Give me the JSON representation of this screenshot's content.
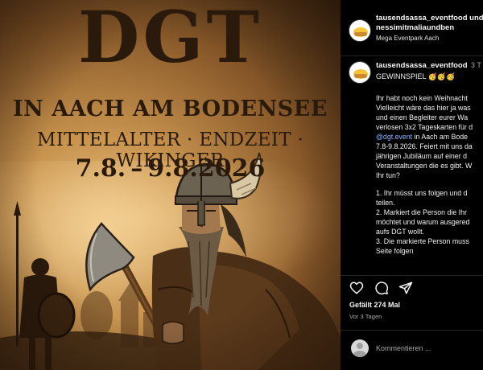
{
  "poster": {
    "title": "DGT",
    "location": "IN AACH AM BODENSEE",
    "themes": "MITTELALTER · ENDZEIT · WIKINGER",
    "dates": "7.8. – 9.8.2026"
  },
  "header": {
    "account_line1": "tausendsassa_eventfood und",
    "account_line2": "nessimitmaliaundben",
    "location": "Mega Eventpark Aach"
  },
  "post": {
    "author": "tausendsassa_eventfood",
    "age": "3 T",
    "tag": "GEWINNSPIEL 🥳🥳🥳",
    "paragraph1": [
      "Ihr habt noch kein Weihnacht",
      "Vielleicht wäre das hier ja was",
      "und einen Begleiter eurer Wa",
      "verlosen 3x2 Tageskarten für d"
    ],
    "mention": "@dgt.event",
    "paragraph1_rest": [
      " in Aach am Bode",
      "7.8-9.8.2026. Feiert mit uns da",
      "jährigen Jubiläum auf einer d",
      "Veranstaltungen die es gibt. W",
      "Ihr tun?"
    ],
    "steps": [
      "1. Ihr müsst uns folgen und d",
      "teilen.",
      "2. Markiert die Person die Ihr",
      "möchtet und warum ausgered",
      "aufs DGT wollt.",
      "3. Die markierte Person muss",
      "Seite folgen"
    ]
  },
  "stats": {
    "likes": "Gefällt 274 Mal",
    "time": "Vor 3 Tagen"
  },
  "comment": {
    "placeholder": "Kommentieren ..."
  },
  "icons": {
    "like": "heart-icon",
    "comment": "comment-icon",
    "share": "share-icon"
  }
}
